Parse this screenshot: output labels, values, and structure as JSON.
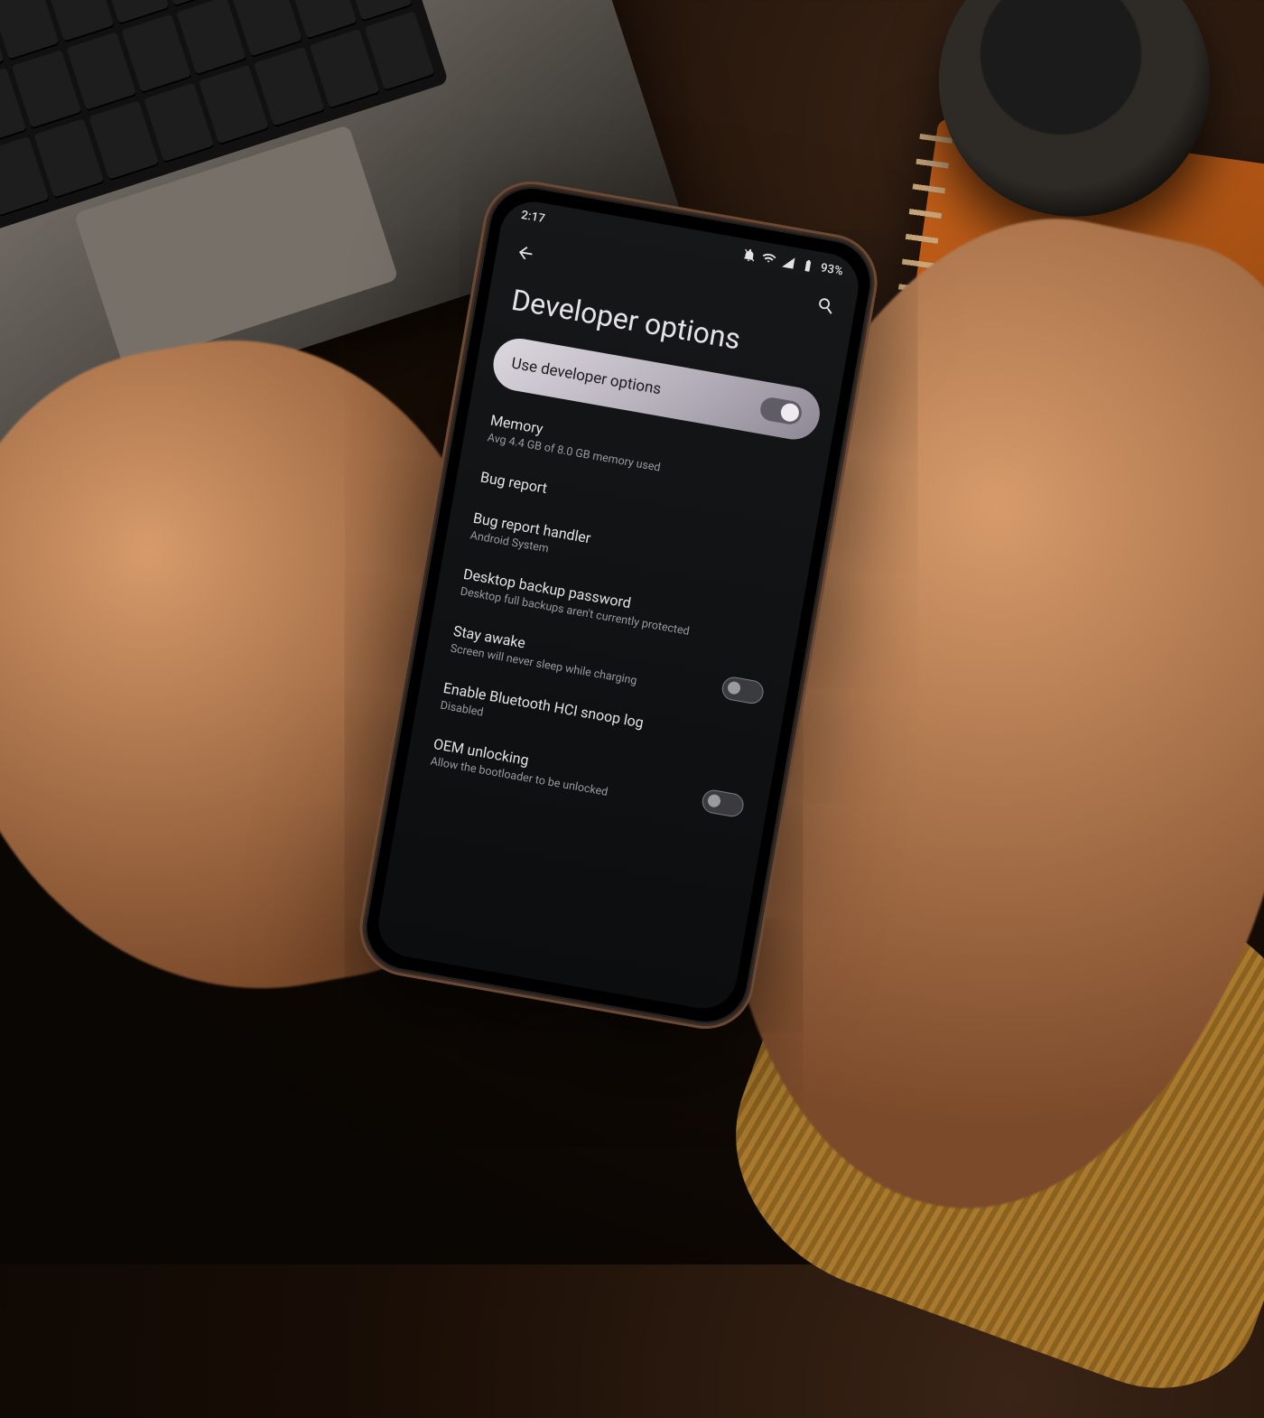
{
  "statusbar": {
    "time": "2:17",
    "battery_pct": "93%"
  },
  "header": {
    "title": "Developer options"
  },
  "master": {
    "label": "Use developer options",
    "enabled": true
  },
  "rows": {
    "memory": {
      "title": "Memory",
      "sub": "Avg 4.4 GB of 8.0 GB memory used"
    },
    "bug_report": {
      "title": "Bug report"
    },
    "bug_report_handler": {
      "title": "Bug report handler",
      "sub": "Android System"
    },
    "desktop_backup": {
      "title": "Desktop backup password",
      "sub": "Desktop full backups aren't currently protected"
    },
    "stay_awake": {
      "title": "Stay awake",
      "sub": "Screen will never sleep while charging",
      "enabled": false
    },
    "bt_snoop": {
      "title": "Enable Bluetooth HCI snoop log",
      "sub": "Disabled"
    },
    "oem_unlock": {
      "title": "OEM unlocking",
      "sub": "Allow the bootloader to be unlocked",
      "enabled": false
    }
  }
}
